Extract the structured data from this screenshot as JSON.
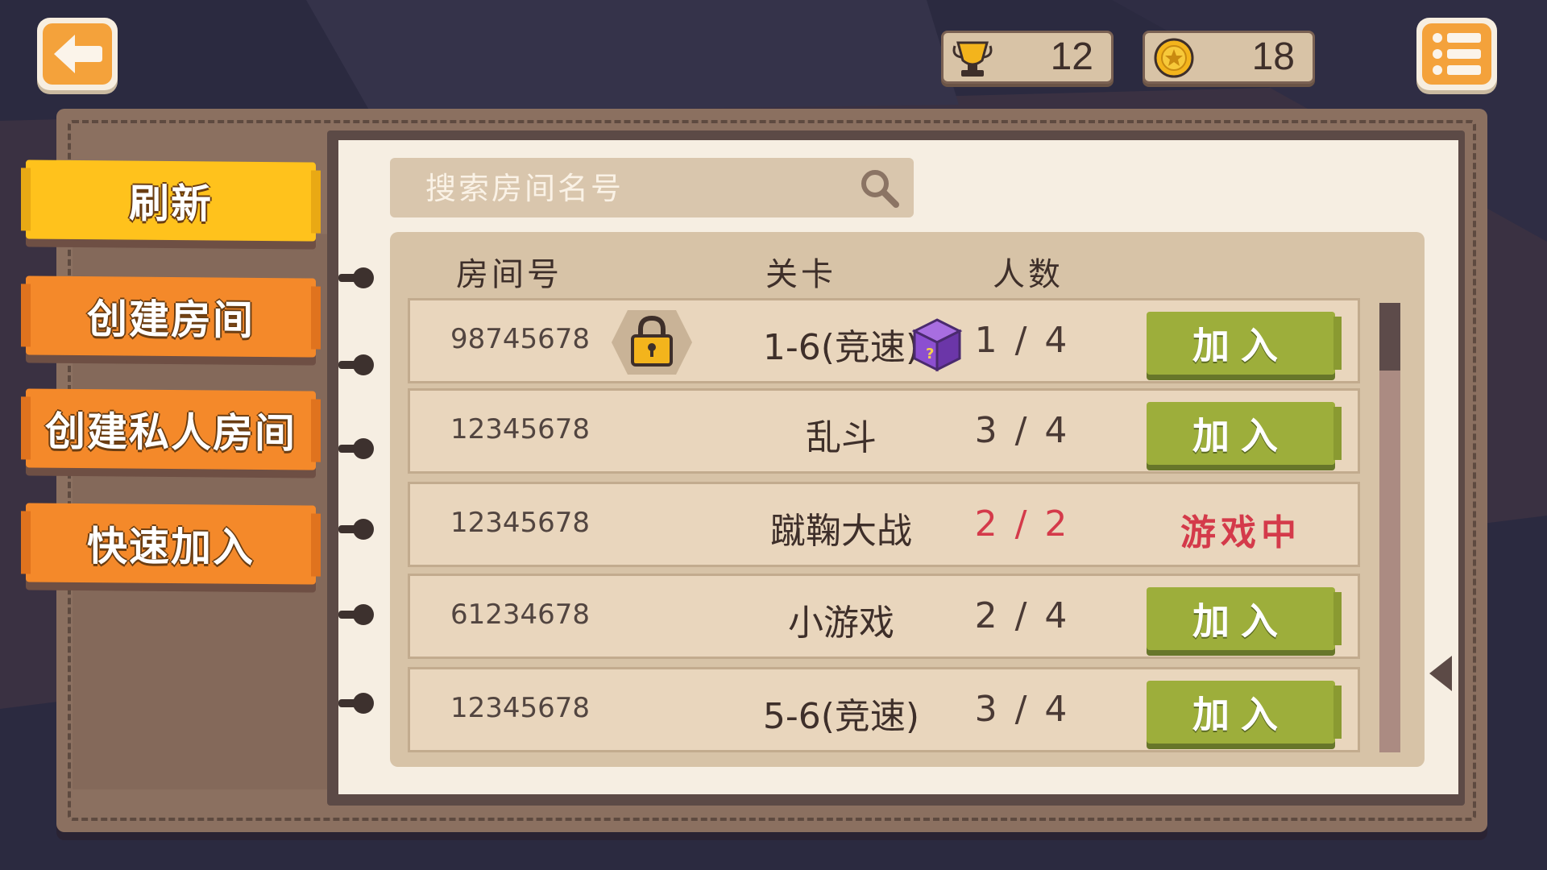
{
  "topbar": {
    "back_icon": "back-arrow-icon",
    "menu_icon": "list-menu-icon",
    "trophy": {
      "icon": "trophy-icon",
      "value": "12"
    },
    "coins": {
      "icon": "coin-icon",
      "value": "18"
    }
  },
  "sidebar": {
    "refresh": "刷新",
    "create_room": "创建房间",
    "create_private_room": "创建私人房间",
    "quick_join": "快速加入"
  },
  "search": {
    "placeholder": "搜索房间名号",
    "icon": "search-icon"
  },
  "table": {
    "headers": {
      "room": "房间号",
      "level": "关卡",
      "players": "人数"
    },
    "rows": [
      {
        "room": "98745678",
        "locked": true,
        "level": "1-6(竞速)",
        "mystery_box": true,
        "players": "1 / 4",
        "action": "加入"
      },
      {
        "room": "12345678",
        "locked": false,
        "level": "乱斗",
        "mystery_box": false,
        "players": "3 / 4",
        "action": "加入"
      },
      {
        "room": "12345678",
        "locked": false,
        "level": "蹴鞠大战",
        "mystery_box": false,
        "players": "2 / 2",
        "status": "游戏中"
      },
      {
        "room": "61234678",
        "locked": false,
        "level": "小游戏",
        "mystery_box": false,
        "players": "2 / 4",
        "action": "加入"
      },
      {
        "room": "12345678",
        "locked": false,
        "level": "5-6(竞速)",
        "mystery_box": false,
        "players": "3 / 4",
        "action": "加入"
      }
    ]
  },
  "colors": {
    "accent_orange": "#f4892a",
    "accent_yellow": "#ffc21c",
    "join_green": "#9dae3b",
    "in_game_red": "#d43a4a"
  }
}
